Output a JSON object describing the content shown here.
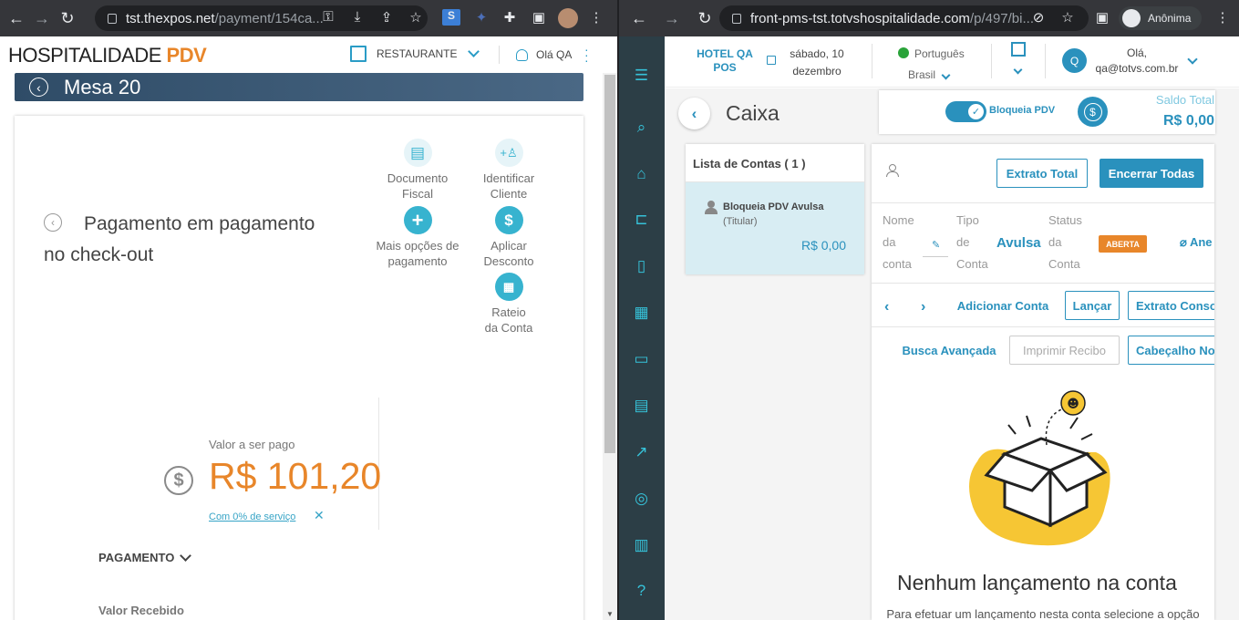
{
  "left": {
    "browser": {
      "url_host": "tst.thexpos.net",
      "url_path": "/payment/154ca..."
    },
    "header": {
      "logo_main": "HOSPITALIDADE",
      "logo_accent": "PDV",
      "restaurant_label": "RESTAURANTE",
      "greeting": "Olá QA"
    },
    "mesa_title": "Mesa 20",
    "payment_title": "Pagamento em pagamento no check-out",
    "options": [
      {
        "label_1": "Documento",
        "label_2": "Fiscal",
        "icon": "document-icon"
      },
      {
        "label_1": "Identificar",
        "label_2": "Cliente",
        "icon": "add-person-icon"
      },
      {
        "label_1": "Mais opções de",
        "label_2": "pagamento",
        "icon": "plus-icon"
      },
      {
        "label_1": "Aplicar",
        "label_2": "Desconto",
        "icon": "dollar-icon"
      },
      {
        "label_1": "Rateio",
        "label_2": "da Conta",
        "icon": "calculator-icon"
      }
    ],
    "valor_label": "Valor a ser pago",
    "valor": "R$ 101,20",
    "servico": "Com 0% de serviço",
    "pagamento_label": "PAGAMENTO",
    "valor_recebido_label": "Valor Recebido",
    "colors": {
      "accent": "#e8862a",
      "brand": "#37b3cf"
    }
  },
  "right": {
    "browser": {
      "url_host": "front-pms-tst.totvshospitalidade.com",
      "url_path": "/p/497/bi...",
      "profile": "Anônima"
    },
    "topbar": {
      "hotel": "HOTEL QA POS",
      "date_1": "sábado, 10",
      "date_2": "dezembro",
      "language": "Português",
      "country": "Brasil",
      "avatar_letter": "Q",
      "greeting_1": "Olá,",
      "greeting_2": "qa@totvs.com.br"
    },
    "caixa_title": "Caixa",
    "bloqueia_label": "Bloqueia PDV",
    "saldo_label": "Saldo Total",
    "saldo_value": "R$ 0,00",
    "lista_contas": "Lista de Contas ( 1 )",
    "account": {
      "name": "Bloqueia PDV Avulsa",
      "role": "(Titular)",
      "value": "R$ 0,00"
    },
    "buttons": {
      "extrato_total": "Extrato Total",
      "encerrar_todas": "Encerrar Todas",
      "adicionar_conta": "Adicionar Conta",
      "lancar": "Lançar",
      "extrato_conso": "Extrato Conso",
      "busca_avancada": "Busca Avançada",
      "imprimir_recibo": "Imprimir Recibo",
      "cabecalho": "Cabeçalho No"
    },
    "fields": {
      "nome_1": "Nome",
      "nome_2": "da",
      "nome_3": "conta",
      "tipo_1": "Tipo",
      "tipo_2": "de",
      "tipo_3": "Conta",
      "tipo_value": "Avulsa",
      "status_1": "Status",
      "status_2": "da",
      "status_3": "Conta",
      "status_badge": "ABERTA",
      "anexo": "Ane"
    },
    "empty_title": "Nenhum lançamento na conta",
    "empty_sub": "Para efetuar um lançamento nesta conta selecione a opção",
    "colors": {
      "brand": "#2a91bd",
      "sidebar": "#2c3e46",
      "badge": "#e8862a"
    }
  }
}
